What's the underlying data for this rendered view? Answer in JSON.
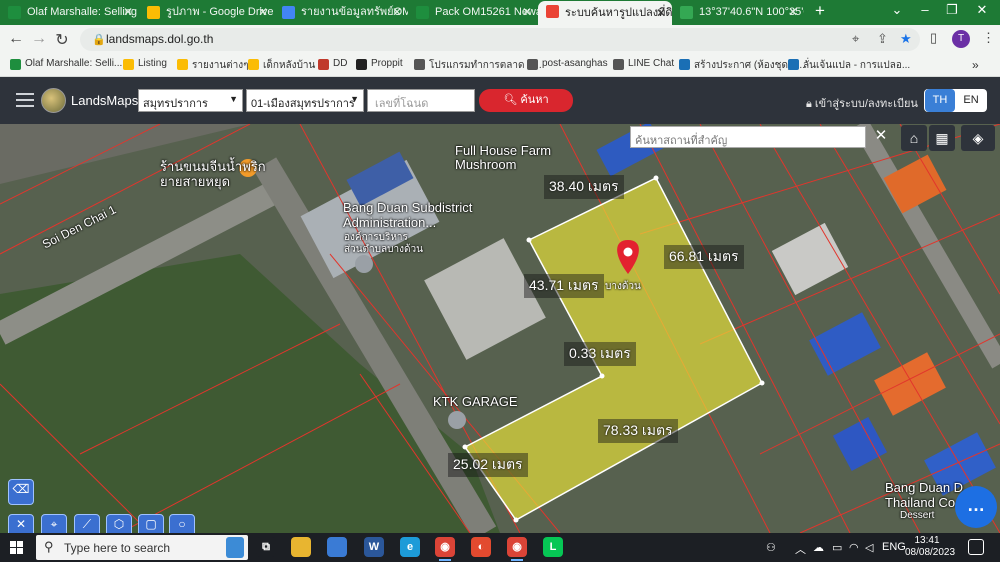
{
  "browser": {
    "tabs": [
      {
        "label": "Olaf Marshalle: Selling",
        "icon_color": "#1e8e3e",
        "active": false
      },
      {
        "label": "รูปภาพ - Google Drive",
        "icon_color": "#fbbc04",
        "active": false
      },
      {
        "label": "รายงานข้อมูลทรัพย์OM152",
        "icon_color": "#4285f4",
        "active": false
      },
      {
        "label": "Pack OM15261 Newat",
        "icon_color": "#1e8e3e",
        "active": false
      },
      {
        "label": "ระบบค้นหารูปแปลงที่ดิน (L",
        "icon_color": "#ea4335",
        "active": true
      },
      {
        "label": "13°37'40.6\"N 100°35'0",
        "icon_color": "#34a853",
        "active": false
      }
    ],
    "new_tab": "+",
    "window_controls": [
      "⌄",
      "–",
      "❐",
      "✕"
    ],
    "url": "landsmaps.dol.go.th",
    "profile_initial": "T",
    "bookmarks": [
      {
        "label": "Olaf Marshalle: Selli...",
        "icon_color": "#1e8e3e"
      },
      {
        "label": "Listing",
        "icon_color": "#fbbc04"
      },
      {
        "label": "รายงานต่างๆ",
        "icon_color": "#fbbc04"
      },
      {
        "label": "เด็กหลังบ้าน",
        "icon_color": "#fbbc04"
      },
      {
        "label": "DD",
        "icon_color": "#c0392b"
      },
      {
        "label": "Proppit",
        "icon_color": "#222222"
      },
      {
        "label": "โปรแกรมทำการตลาด อ...",
        "icon_color": "#555555"
      },
      {
        "label": "post-asanghas",
        "icon_color": "#555555"
      },
      {
        "label": "LINE Chat",
        "icon_color": "#555555"
      },
      {
        "label": "สร้างประกาศ (ห้องชุด) |...",
        "icon_color": "#1a6fb5"
      },
      {
        "label": "ลั่นเจ้นแปล - การแปลอ...",
        "icon_color": "#1a6fb5"
      }
    ],
    "bookmarks_more": "»"
  },
  "app": {
    "brand": "LandsMaps",
    "province": "สมุทรปราการ",
    "district": "01-เมืองสมุทรปราการ",
    "deed_placeholder": "เลขที่โฉนด",
    "search_label": "ค้นหา",
    "login_label": "เข้าสู่ระบบ/ลงทะเบียน",
    "lang_th": "TH",
    "lang_en": "EN"
  },
  "map": {
    "search_placeholder": "ค้นหาสถานที่สำคัญ",
    "close": "✕",
    "labels": [
      {
        "text": "Full House Farm\nMushroom"
      },
      {
        "text": "ร้านขนมจีนน้ำพริก\nยายสายหยุด"
      },
      {
        "text": "Soi Den Chai 1"
      },
      {
        "text": "Bang Duan Subdistrict\nAdministration..."
      },
      {
        "text": "องค์การบริหาร\nส่วนตำบลบางด้วน"
      },
      {
        "text": "KTK GARAGE"
      },
      {
        "text": "Bang Duan D...\nThailand Co..."
      },
      {
        "text": "Dessert"
      },
      {
        "text": "บางด้วน"
      }
    ],
    "distances": [
      {
        "text": "38.40 เมตร"
      },
      {
        "text": "66.81 เมตร"
      },
      {
        "text": "43.71 เมตร"
      },
      {
        "text": "0.33 เมตร"
      },
      {
        "text": "78.33 เมตร"
      },
      {
        "text": "25.02 เมตร"
      }
    ],
    "parcel_color": "#e8e23a",
    "pin_color": "#e3222f"
  },
  "taskbar": {
    "search_placeholder": "Type here to search",
    "lang": "ENG",
    "time": "13:41",
    "date": "08/08/2023",
    "apps": [
      {
        "name": "task-view-icon",
        "color": "#1c1f24",
        "glyph": "⧉"
      },
      {
        "name": "file-explorer-icon",
        "color": "#e8b530",
        "glyph": ""
      },
      {
        "name": "store-icon",
        "color": "#3a7bd5",
        "glyph": ""
      },
      {
        "name": "word-icon",
        "color": "#2b579a",
        "glyph": "W"
      },
      {
        "name": "edge-icon",
        "color": "#1d9bd8",
        "glyph": "e"
      },
      {
        "name": "chrome-icon",
        "color": "#db4437",
        "glyph": "◉"
      },
      {
        "name": "swirl-app-icon",
        "color": "#e24a2f",
        "glyph": "◐"
      },
      {
        "name": "chrome-profile-icon",
        "color": "#db4437",
        "glyph": "◉"
      },
      {
        "name": "line-icon",
        "color": "#06c755",
        "glyph": "L"
      }
    ]
  }
}
